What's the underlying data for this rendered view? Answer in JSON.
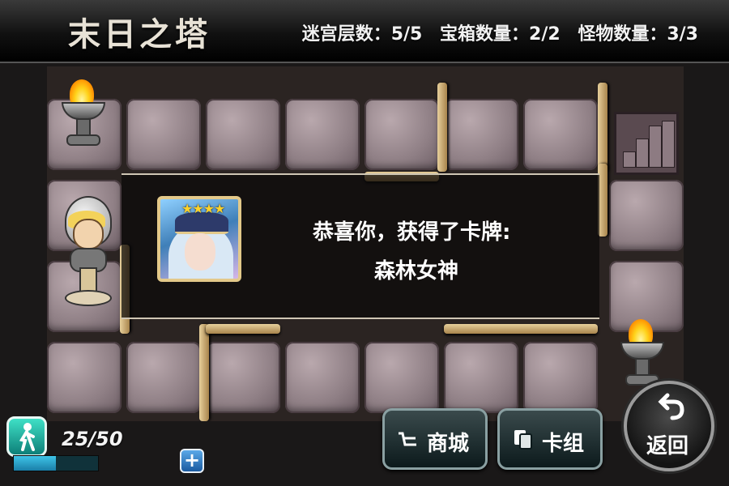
{
  "header": {
    "title": "末日之塔",
    "floor": "迷宫层数：5/5",
    "chests": "宝箱数量：2/2",
    "monsters": "怪物数量：3/3"
  },
  "dialog": {
    "line1": "恭喜你，获得了卡牌:",
    "line2": "森林女神",
    "card_stars": "★★★★"
  },
  "stamina": {
    "text": "25/50",
    "current": 25,
    "max": 50,
    "add_label": "+"
  },
  "buttons": {
    "shop": "商城",
    "deck": "卡组",
    "back": "返回"
  },
  "icons": {
    "shop": "cart-icon",
    "deck": "cards-icon",
    "back": "return-arrow-icon",
    "stamina": "walking-figure-icon"
  },
  "colors": {
    "accent": "#2fc0e0",
    "flame": "#ffd21a"
  }
}
